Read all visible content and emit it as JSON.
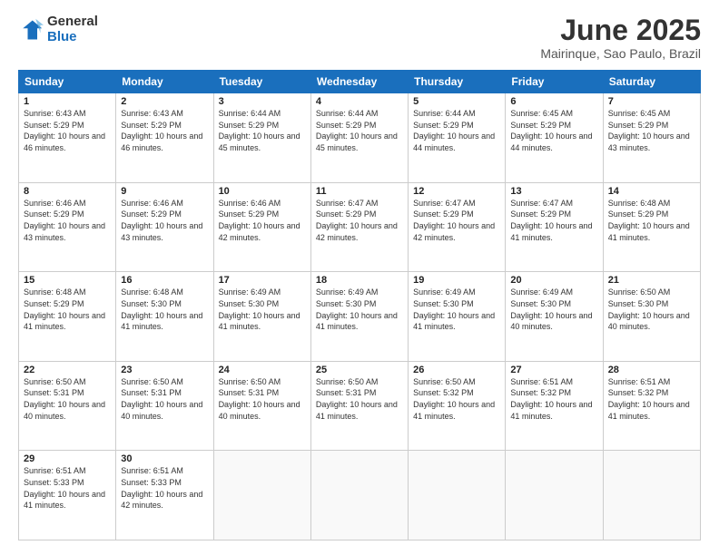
{
  "logo": {
    "general": "General",
    "blue": "Blue"
  },
  "title": "June 2025",
  "subtitle": "Mairinque, Sao Paulo, Brazil",
  "headers": [
    "Sunday",
    "Monday",
    "Tuesday",
    "Wednesday",
    "Thursday",
    "Friday",
    "Saturday"
  ],
  "weeks": [
    [
      {
        "day": "1",
        "sunrise": "6:43 AM",
        "sunset": "5:29 PM",
        "daylight": "10 hours and 46 minutes."
      },
      {
        "day": "2",
        "sunrise": "6:43 AM",
        "sunset": "5:29 PM",
        "daylight": "10 hours and 46 minutes."
      },
      {
        "day": "3",
        "sunrise": "6:44 AM",
        "sunset": "5:29 PM",
        "daylight": "10 hours and 45 minutes."
      },
      {
        "day": "4",
        "sunrise": "6:44 AM",
        "sunset": "5:29 PM",
        "daylight": "10 hours and 45 minutes."
      },
      {
        "day": "5",
        "sunrise": "6:44 AM",
        "sunset": "5:29 PM",
        "daylight": "10 hours and 44 minutes."
      },
      {
        "day": "6",
        "sunrise": "6:45 AM",
        "sunset": "5:29 PM",
        "daylight": "10 hours and 44 minutes."
      },
      {
        "day": "7",
        "sunrise": "6:45 AM",
        "sunset": "5:29 PM",
        "daylight": "10 hours and 43 minutes."
      }
    ],
    [
      {
        "day": "8",
        "sunrise": "6:46 AM",
        "sunset": "5:29 PM",
        "daylight": "10 hours and 43 minutes."
      },
      {
        "day": "9",
        "sunrise": "6:46 AM",
        "sunset": "5:29 PM",
        "daylight": "10 hours and 43 minutes."
      },
      {
        "day": "10",
        "sunrise": "6:46 AM",
        "sunset": "5:29 PM",
        "daylight": "10 hours and 42 minutes."
      },
      {
        "day": "11",
        "sunrise": "6:47 AM",
        "sunset": "5:29 PM",
        "daylight": "10 hours and 42 minutes."
      },
      {
        "day": "12",
        "sunrise": "6:47 AM",
        "sunset": "5:29 PM",
        "daylight": "10 hours and 42 minutes."
      },
      {
        "day": "13",
        "sunrise": "6:47 AM",
        "sunset": "5:29 PM",
        "daylight": "10 hours and 41 minutes."
      },
      {
        "day": "14",
        "sunrise": "6:48 AM",
        "sunset": "5:29 PM",
        "daylight": "10 hours and 41 minutes."
      }
    ],
    [
      {
        "day": "15",
        "sunrise": "6:48 AM",
        "sunset": "5:29 PM",
        "daylight": "10 hours and 41 minutes."
      },
      {
        "day": "16",
        "sunrise": "6:48 AM",
        "sunset": "5:30 PM",
        "daylight": "10 hours and 41 minutes."
      },
      {
        "day": "17",
        "sunrise": "6:49 AM",
        "sunset": "5:30 PM",
        "daylight": "10 hours and 41 minutes."
      },
      {
        "day": "18",
        "sunrise": "6:49 AM",
        "sunset": "5:30 PM",
        "daylight": "10 hours and 41 minutes."
      },
      {
        "day": "19",
        "sunrise": "6:49 AM",
        "sunset": "5:30 PM",
        "daylight": "10 hours and 41 minutes."
      },
      {
        "day": "20",
        "sunrise": "6:49 AM",
        "sunset": "5:30 PM",
        "daylight": "10 hours and 40 minutes."
      },
      {
        "day": "21",
        "sunrise": "6:50 AM",
        "sunset": "5:30 PM",
        "daylight": "10 hours and 40 minutes."
      }
    ],
    [
      {
        "day": "22",
        "sunrise": "6:50 AM",
        "sunset": "5:31 PM",
        "daylight": "10 hours and 40 minutes."
      },
      {
        "day": "23",
        "sunrise": "6:50 AM",
        "sunset": "5:31 PM",
        "daylight": "10 hours and 40 minutes."
      },
      {
        "day": "24",
        "sunrise": "6:50 AM",
        "sunset": "5:31 PM",
        "daylight": "10 hours and 40 minutes."
      },
      {
        "day": "25",
        "sunrise": "6:50 AM",
        "sunset": "5:31 PM",
        "daylight": "10 hours and 41 minutes."
      },
      {
        "day": "26",
        "sunrise": "6:50 AM",
        "sunset": "5:32 PM",
        "daylight": "10 hours and 41 minutes."
      },
      {
        "day": "27",
        "sunrise": "6:51 AM",
        "sunset": "5:32 PM",
        "daylight": "10 hours and 41 minutes."
      },
      {
        "day": "28",
        "sunrise": "6:51 AM",
        "sunset": "5:32 PM",
        "daylight": "10 hours and 41 minutes."
      }
    ],
    [
      {
        "day": "29",
        "sunrise": "6:51 AM",
        "sunset": "5:33 PM",
        "daylight": "10 hours and 41 minutes."
      },
      {
        "day": "30",
        "sunrise": "6:51 AM",
        "sunset": "5:33 PM",
        "daylight": "10 hours and 42 minutes."
      },
      null,
      null,
      null,
      null,
      null
    ]
  ]
}
